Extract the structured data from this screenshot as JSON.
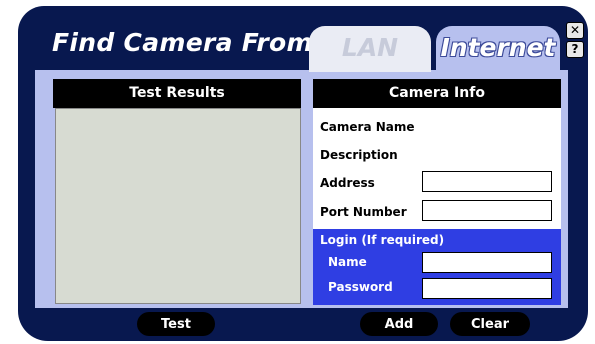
{
  "window": {
    "title": "Find Camera From",
    "tabs": {
      "lan": "LAN",
      "internet": "Internet"
    },
    "close_glyph": "✕",
    "help_glyph": "?"
  },
  "test_results": {
    "header": "Test Results"
  },
  "camera_info": {
    "header": "Camera Info",
    "camera_name_label": "Camera Name",
    "description_label": "Description",
    "address_label": "Address",
    "address_value": "",
    "port_label": "Port Number",
    "port_value": ""
  },
  "login": {
    "title": "Login (If required)",
    "name_label": "Name",
    "name_value": "",
    "password_label": "Password",
    "password_value": ""
  },
  "buttons": {
    "test": "Test",
    "add": "Add",
    "clear": "Clear"
  },
  "colors": {
    "frame": "#08184f",
    "panel": "#b7c0ee",
    "header_bar": "#000000",
    "login_bar": "#2f3ee3",
    "results_box": "#d7dbd2"
  }
}
